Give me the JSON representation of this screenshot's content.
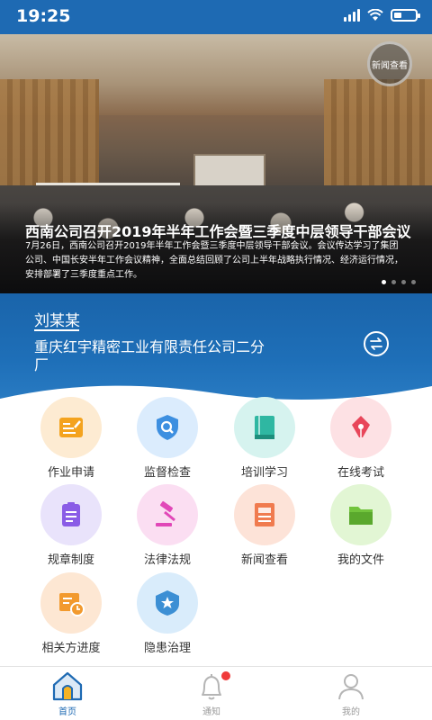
{
  "status_bar": {
    "time": "19:25",
    "battery_level": 0.35
  },
  "banner": {
    "badge_label": "新闻查看",
    "title": "西南公司召开2019年半年工作会暨三季度中层领导干部会议",
    "description": "7月26日，西南公司召开2019年半年工作会暨三季度中层领导干部会议。会议传达学习了集团公司、中国长安半年工作会议精神，全面总结回顾了公司上半年战略执行情况、经济运行情况，安排部署了三季度重点工作。",
    "dots_count": 4,
    "active_dot": 0
  },
  "profile": {
    "name": "刘某某",
    "company": "重庆红宇精密工业有限责任公司二分厂",
    "switch_icon": "switch-arrows-icon"
  },
  "menu": [
    {
      "label": "作业申请",
      "icon": "application-form-icon",
      "bg": "#fdebd2",
      "fg": "#f4a31e"
    },
    {
      "label": "监督检查",
      "icon": "shield-search-icon",
      "bg": "#dbecfd",
      "fg": "#3d8fe0"
    },
    {
      "label": "培训学习",
      "icon": "book-icon",
      "bg": "#d6f3ef",
      "fg": "#2fb7a2"
    },
    {
      "label": "在线考试",
      "icon": "pen-nib-icon",
      "bg": "#fde1e4",
      "fg": "#e8465a"
    },
    {
      "label": "规章制度",
      "icon": "rules-document-icon",
      "bg": "#e9e3fb",
      "fg": "#8a5ce6"
    },
    {
      "label": "法律法规",
      "icon": "gavel-icon",
      "bg": "#fbdef2",
      "fg": "#e147b8"
    },
    {
      "label": "新闻查看",
      "icon": "newspaper-icon",
      "bg": "#fde3d8",
      "fg": "#f07b4f"
    },
    {
      "label": "我的文件",
      "icon": "folder-icon",
      "bg": "#e2f6d4",
      "fg": "#72c43d"
    },
    {
      "label": "相关方进度",
      "icon": "progress-clock-icon",
      "bg": "#fde7d3",
      "fg": "#f29a2e"
    },
    {
      "label": "隐患治理",
      "icon": "badge-star-icon",
      "bg": "#d9ecfb",
      "fg": "#3c8fd4"
    }
  ],
  "tabbar": [
    {
      "label": "首页",
      "icon": "home-icon",
      "active": true
    },
    {
      "label": "通知",
      "icon": "bell-icon",
      "active": false,
      "has_dot": true
    },
    {
      "label": "我的",
      "icon": "user-icon",
      "active": false
    }
  ]
}
